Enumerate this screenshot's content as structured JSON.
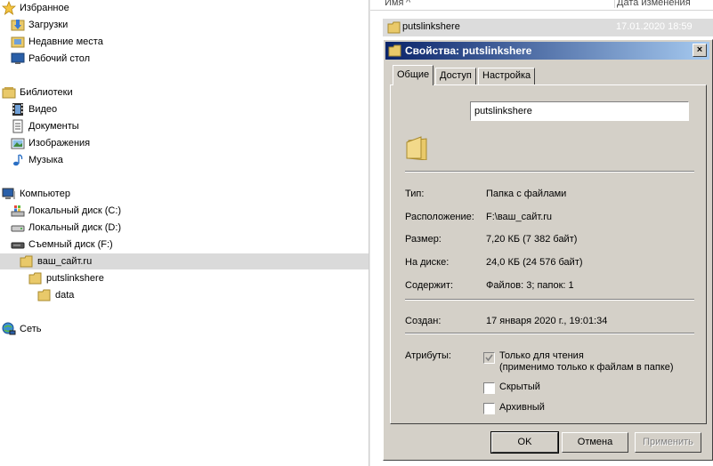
{
  "nav": {
    "favorites": "Избранное",
    "downloads": "Загрузки",
    "recent": "Недавние места",
    "desktop": "Рабочий стол",
    "libraries": "Библиотеки",
    "video": "Видео",
    "documents": "Документы",
    "images": "Изображения",
    "music": "Музыка",
    "computer": "Компьютер",
    "disk_c": "Локальный диск (C:)",
    "disk_d": "Локальный диск (D:)",
    "disk_f": "Съемный диск (F:)",
    "site": "ваш_сайт.ru",
    "putslinkshere": "putslinkshere",
    "data": "data",
    "network": "Сеть"
  },
  "list": {
    "col_name": "Имя",
    "col_date": "Дата изменения",
    "file_name": "putslinkshere",
    "file_date": "17.01.2020 18:59"
  },
  "dialog": {
    "title": "Свойства: putslinkshere",
    "close": "×",
    "tabs": [
      "Общие",
      "Доступ",
      "Настройка"
    ],
    "folder_name": "putslinkshere",
    "type_label": "Тип:",
    "type_value": "Папка с файлами",
    "location_label": "Расположение:",
    "location_value": "F:\\ваш_сайт.ru",
    "size_label": "Размер:",
    "size_value": "7,20 КБ (7 382 байт)",
    "disk_label": "На диске:",
    "disk_value": "24,0 КБ (24 576 байт)",
    "contains_label": "Содержит:",
    "contains_value": "Файлов: 3; папок: 1",
    "created_label": "Создан:",
    "created_value": "17 января 2020 г., 19:01:34",
    "attributes_label": "Атрибуты:",
    "readonly_label": "Только для чтения",
    "readonly_note": "(применимо только к файлам в папке)",
    "readonly_checked": true,
    "hidden_label": "Скрытый",
    "hidden_checked": false,
    "archive_label": "Архивный",
    "archive_checked": false,
    "ok": "OK",
    "cancel": "Отмена",
    "apply": "Применить"
  }
}
